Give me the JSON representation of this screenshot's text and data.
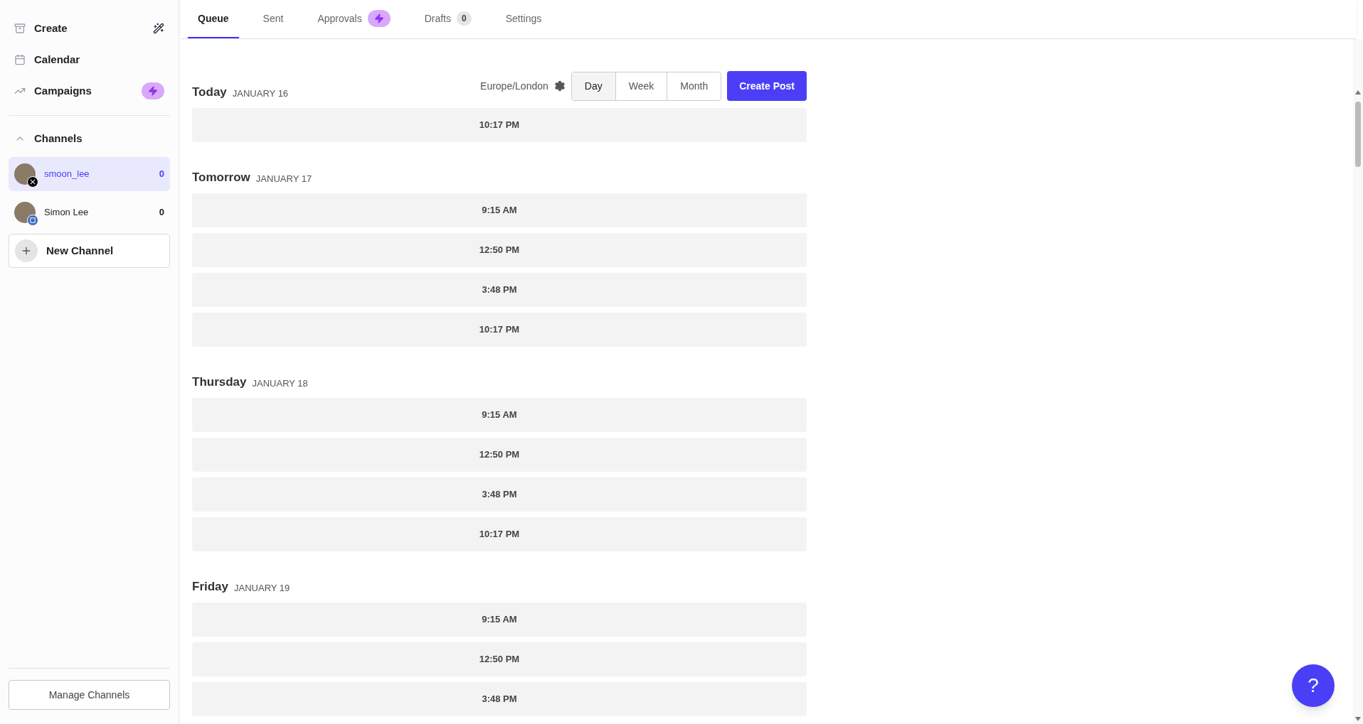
{
  "sidebar": {
    "nav": [
      {
        "label": "Create",
        "kind": "create"
      },
      {
        "label": "Calendar",
        "kind": "calendar"
      },
      {
        "label": "Campaigns",
        "kind": "campaigns"
      }
    ],
    "channels_section": {
      "title": "Channels",
      "expanded": true
    },
    "channels": [
      {
        "name": "smoon_lee",
        "count": "0",
        "selected": true,
        "kind": "x"
      },
      {
        "name": "Simon Lee",
        "count": "0",
        "selected": false,
        "kind": "linkedin"
      }
    ],
    "new_channel": "New Channel",
    "manage_button": "Manage Channels"
  },
  "tabs": [
    {
      "label": "Queue",
      "selected": true
    },
    {
      "label": "Sent",
      "selected": false
    },
    {
      "label": "Approvals",
      "selected": false,
      "kind": "bolt"
    },
    {
      "label": "Drafts",
      "selected": false,
      "kind": "count",
      "count": "0"
    },
    {
      "label": "Settings",
      "selected": false
    }
  ],
  "toolbar": {
    "timezone": "Europe/London",
    "views": [
      {
        "label": "Day",
        "selected": true
      },
      {
        "label": "Week",
        "selected": false
      },
      {
        "label": "Month",
        "selected": false
      }
    ],
    "create_button": "Create Post"
  },
  "days": [
    {
      "title": "Today",
      "date": "JANUARY 16",
      "slots": [
        "10:17 PM"
      ]
    },
    {
      "title": "Tomorrow",
      "date": "JANUARY 17",
      "slots": [
        "9:15 AM",
        "12:50 PM",
        "3:48 PM",
        "10:17 PM"
      ]
    },
    {
      "title": "Thursday",
      "date": "JANUARY 18",
      "slots": [
        "9:15 AM",
        "12:50 PM",
        "3:48 PM",
        "10:17 PM"
      ]
    },
    {
      "title": "Friday",
      "date": "JANUARY 19",
      "slots": [
        "9:15 AM",
        "12:50 PM",
        "3:48 PM"
      ]
    }
  ],
  "help_button": "?"
}
